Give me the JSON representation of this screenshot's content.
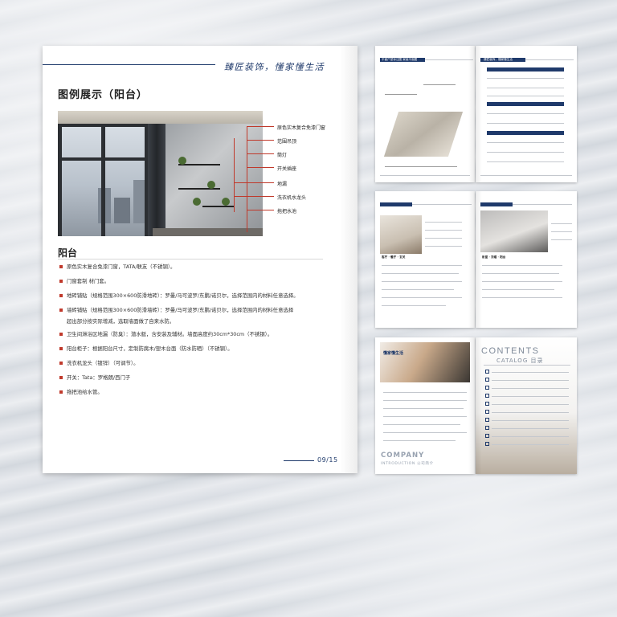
{
  "main_page": {
    "slogan": "臻匠装饰，懂家懂生活",
    "section_title": "图例展示（阳台）",
    "annotations": [
      "原色实木复合免漆门窗",
      "范围吊顶",
      "筒灯",
      "开关插座",
      "地漏",
      "洗衣机水龙头",
      "拖把水池"
    ],
    "subsection_title": "阳台",
    "bullets": [
      "原色实木复合免漆门窗，TATA/联友（不锈钢）。",
      "门窗套制 材门套。",
      "地砖铺贴（规格范围300×600防滑地砖）：罗曼/马可波罗/东鹏/诺贝尔，选择范围内的材料任意选择。",
      "墙砖铺贴（规格范围300×600防滑墙砖）：罗曼/马可波罗/东鹏/诺贝尔，选择范围内的材料任意选择",
      "超出部分按实际增减，选取墙面做了自来水防。",
      "卫生间淋浴区地漏（防臭）：潜水艇，含安装及辅材。墙面高度约30cm*30cm（不锈钢）。",
      "阳台柜子：根据阳台尺寸，定制防腐木/塑木台面（防水防晒）（不锈钢）。",
      "洗衣机龙头（镀锌）（可调节）。",
      "开关：Tata：罗格朗/西门子",
      "拖把池给水管。"
    ],
    "page_number": "09/15"
  },
  "thumbnails": {
    "spread1_left_header": "平面户型标注图  家装平面图",
    "spread1_right_header": "臻匠装饰，懂家懂生活",
    "spread2_left_caption": "客厅 · 餐厅 · 玄关",
    "spread2_right_caption": "卧室 · 衣帽 · 阳台",
    "spread3_left_heading": "懂家懂生活",
    "company_label": "COMPANY",
    "company_sub": "INTRODUCTION 公司简介",
    "contents_label": "CONTENTS",
    "catalog_label": "CATALOG 目录"
  },
  "colors": {
    "navy": "#1f3a6b",
    "accent_red": "#c0392b"
  }
}
